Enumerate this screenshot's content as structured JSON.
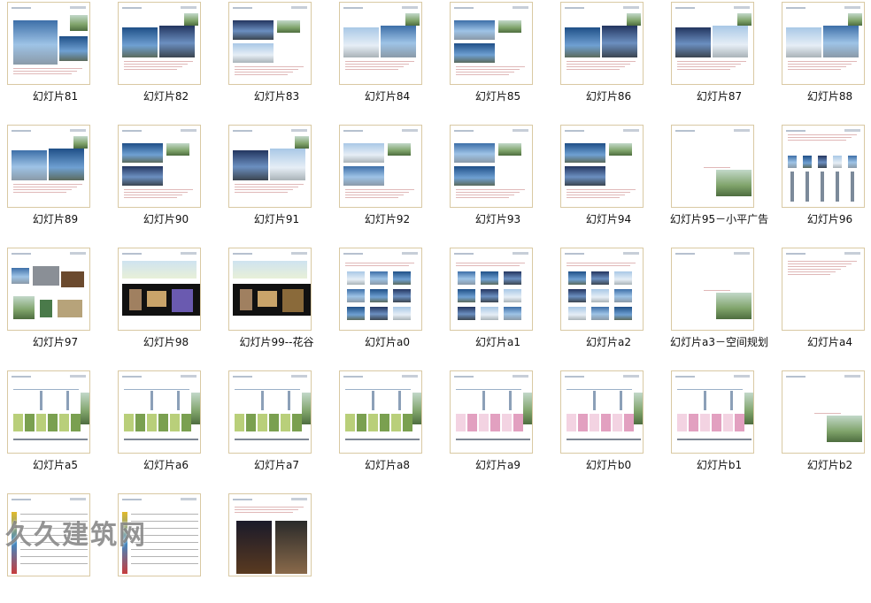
{
  "slides": [
    {
      "label": "幻灯片81",
      "style": "photo3"
    },
    {
      "label": "幻灯片82",
      "style": "photo2"
    },
    {
      "label": "幻灯片83",
      "style": "photo2b"
    },
    {
      "label": "幻灯片84",
      "style": "photo2"
    },
    {
      "label": "幻灯片85",
      "style": "photo2b"
    },
    {
      "label": "幻灯片86",
      "style": "photo2"
    },
    {
      "label": "幻灯片87",
      "style": "photo2"
    },
    {
      "label": "幻灯片88",
      "style": "photo2"
    },
    {
      "label": "幻灯片89",
      "style": "photo2"
    },
    {
      "label": "幻灯片90",
      "style": "photo2b"
    },
    {
      "label": "幻灯片91",
      "style": "photo2"
    },
    {
      "label": "幻灯片92",
      "style": "photo2b"
    },
    {
      "label": "幻灯片93",
      "style": "photo2b"
    },
    {
      "label": "幻灯片94",
      "style": "photo2b"
    },
    {
      "label": "幻灯片95－小平广告",
      "style": "single"
    },
    {
      "label": "幻灯片96",
      "style": "columns"
    },
    {
      "label": "幻灯片97",
      "style": "collage"
    },
    {
      "label": "幻灯片98",
      "style": "darkpanel"
    },
    {
      "label": "幻灯片99--花谷",
      "style": "darkpanel2"
    },
    {
      "label": "幻灯片a0",
      "style": "photogrid"
    },
    {
      "label": "幻灯片a1",
      "style": "photogrid"
    },
    {
      "label": "幻灯片a2",
      "style": "photogrid"
    },
    {
      "label": "幻灯片a3－空间规划",
      "style": "single"
    },
    {
      "label": "幻灯片a4",
      "style": "textonly"
    },
    {
      "label": "幻灯片a5",
      "style": "section"
    },
    {
      "label": "幻灯片a6",
      "style": "section"
    },
    {
      "label": "幻灯片a7",
      "style": "section"
    },
    {
      "label": "幻灯片a8",
      "style": "section"
    },
    {
      "label": "幻灯片a9",
      "style": "sectionpink"
    },
    {
      "label": "幻灯片b0",
      "style": "sectionpink"
    },
    {
      "label": "幻灯片b1",
      "style": "sectionpink"
    },
    {
      "label": "幻灯片b2",
      "style": "single"
    },
    {
      "label": "",
      "style": "table"
    },
    {
      "label": "",
      "style": "table"
    },
    {
      "label": "",
      "style": "night"
    }
  ],
  "watermark": "久久建筑网"
}
